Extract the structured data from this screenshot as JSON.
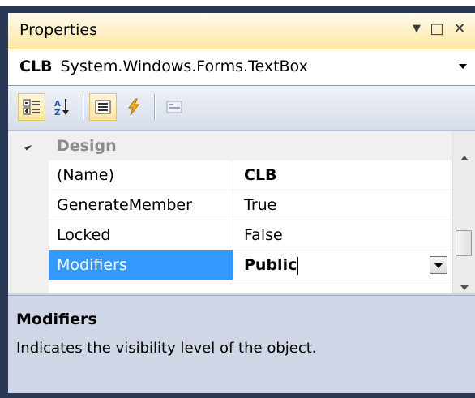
{
  "window": {
    "title": "Properties",
    "buttons": {
      "dropdown": "▼",
      "maximize": "□",
      "close": "✕"
    }
  },
  "selector": {
    "object_name": "CLB",
    "object_type": "System.Windows.Forms.TextBox"
  },
  "toolbar": {
    "buttons": [
      {
        "icon": "categorized-icon",
        "active": true
      },
      {
        "icon": "alphabetical-sort-icon",
        "active": false
      },
      {
        "icon": "properties-icon",
        "active": true
      },
      {
        "icon": "events-lightning-icon",
        "active": false
      },
      {
        "icon": "property-pages-icon",
        "active": false
      }
    ]
  },
  "grid": {
    "category": "Design",
    "rows": [
      {
        "name": "(Name)",
        "value": "CLB",
        "bold": true
      },
      {
        "name": "GenerateMember",
        "value": "True",
        "bold": false
      },
      {
        "name": "Locked",
        "value": "False",
        "bold": false
      },
      {
        "name": "Modifiers",
        "value": "Public",
        "bold": true,
        "selected": true
      }
    ]
  },
  "description": {
    "title": "Modifiers",
    "text": "Indicates the visibility level of the object."
  },
  "colors": {
    "title_bar": "#ffe8a6",
    "frame": "#293955",
    "selection": "#3399ff",
    "panel": "#cfd6e5"
  }
}
